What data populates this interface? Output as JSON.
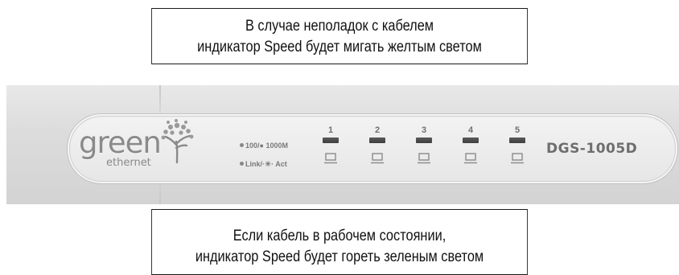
{
  "callouts": {
    "top": {
      "line1": "В случае неполадок с кабелем",
      "line2": "индикатор Speed будет мигать желтым светом"
    },
    "bottom": {
      "line1": "Если кабель в рабочем состоянии,",
      "line2": "индикатор Speed будет гореть зеленым светом"
    }
  },
  "device": {
    "logo_main": "green",
    "logo_sub": "ethernet",
    "legend_speed": "100/● 1000M",
    "legend_link": "Link/·☀· Act",
    "ports": [
      {
        "label": "1"
      },
      {
        "label": "2"
      },
      {
        "label": "3"
      },
      {
        "label": "4"
      },
      {
        "label": "5"
      }
    ],
    "model": "DGS-1005D",
    "colors": {
      "panel": "#d9d9d9",
      "bezel": "#ececec",
      "led": "#4a4a4a",
      "label": "#7a7a7a"
    }
  }
}
